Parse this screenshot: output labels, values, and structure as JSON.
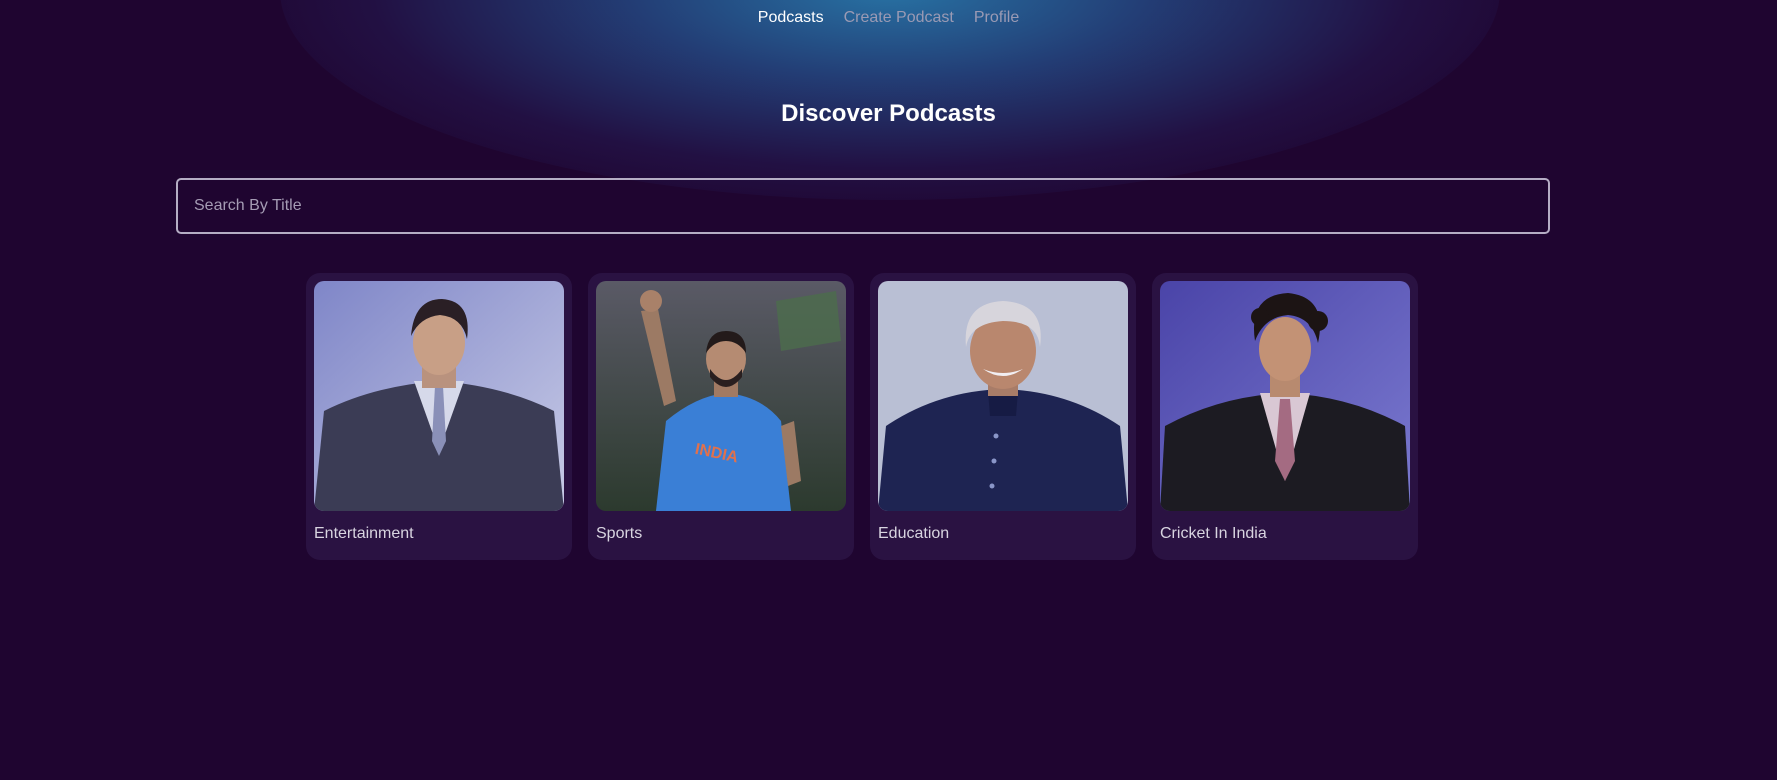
{
  "nav": {
    "items": [
      {
        "label": "Podcasts",
        "active": true
      },
      {
        "label": "Create Podcast",
        "active": false
      },
      {
        "label": "Profile",
        "active": false
      }
    ]
  },
  "main": {
    "title": "Discover Podcasts",
    "search": {
      "placeholder": "Search By Title",
      "value": ""
    }
  },
  "podcasts": [
    {
      "label": "Entertainment",
      "image": "man-in-grey-suit-portrait"
    },
    {
      "label": "Sports",
      "image": "cricketer-in-blue-jersey-fist-raised"
    },
    {
      "label": "Education",
      "image": "smiling-man-in-dark-jacket-portrait"
    },
    {
      "label": "Cricket In India",
      "image": "man-in-black-suit-portrait"
    }
  ],
  "colors": {
    "background": "#1f0530",
    "glow": "#2878aa",
    "card": "#2a1242",
    "nav_active": "#ffffff",
    "nav_inactive": "#9a9ab4"
  }
}
